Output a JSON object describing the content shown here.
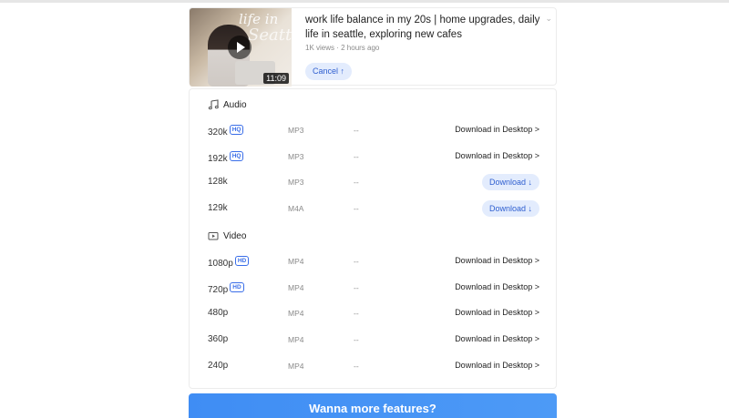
{
  "video": {
    "title": "work life balance in my 20s | home upgrades, daily life in seattle, exploring new cafes",
    "meta": "1K views · 2 hours ago",
    "duration": "11:09",
    "thumb_text_1": "life in",
    "thumb_text_2": "Seatt",
    "cancel_label": "Cancel ↑",
    "chevron": "⌄"
  },
  "audio": {
    "heading": "Audio",
    "icon": "music-note-icon",
    "rows": [
      {
        "quality": "320k",
        "badge": "HQ",
        "format": "MP3",
        "size": "--",
        "action": "Download in Desktop >"
      },
      {
        "quality": "192k",
        "badge": "HQ",
        "format": "MP3",
        "size": "--",
        "action": "Download in Desktop >"
      },
      {
        "quality": "128k",
        "badge": "",
        "format": "MP3",
        "size": "--",
        "action": "Download ↓"
      },
      {
        "quality": "129k",
        "badge": "",
        "format": "M4A",
        "size": "--",
        "action": "Download ↓"
      }
    ]
  },
  "video_section": {
    "heading": "Video",
    "icon": "video-camera-icon",
    "rows": [
      {
        "quality": "1080p",
        "badge": "HD",
        "format": "MP4",
        "size": "--",
        "action": "Download in Desktop >"
      },
      {
        "quality": "720p",
        "badge": "HD",
        "format": "MP4",
        "size": "--",
        "action": "Download in Desktop >"
      },
      {
        "quality": "480p",
        "badge": "",
        "format": "MP4",
        "size": "--",
        "action": "Download in Desktop >"
      },
      {
        "quality": "360p",
        "badge": "",
        "format": "MP4",
        "size": "--",
        "action": "Download in Desktop >"
      },
      {
        "quality": "240p",
        "badge": "",
        "format": "MP4",
        "size": "--",
        "action": "Download in Desktop >"
      }
    ]
  },
  "cta": {
    "label": "Wanna more features?"
  },
  "colors": {
    "accent": "#2f5fd0",
    "pill_bg": "#e3ecfd",
    "cta": "#4d9af6"
  }
}
